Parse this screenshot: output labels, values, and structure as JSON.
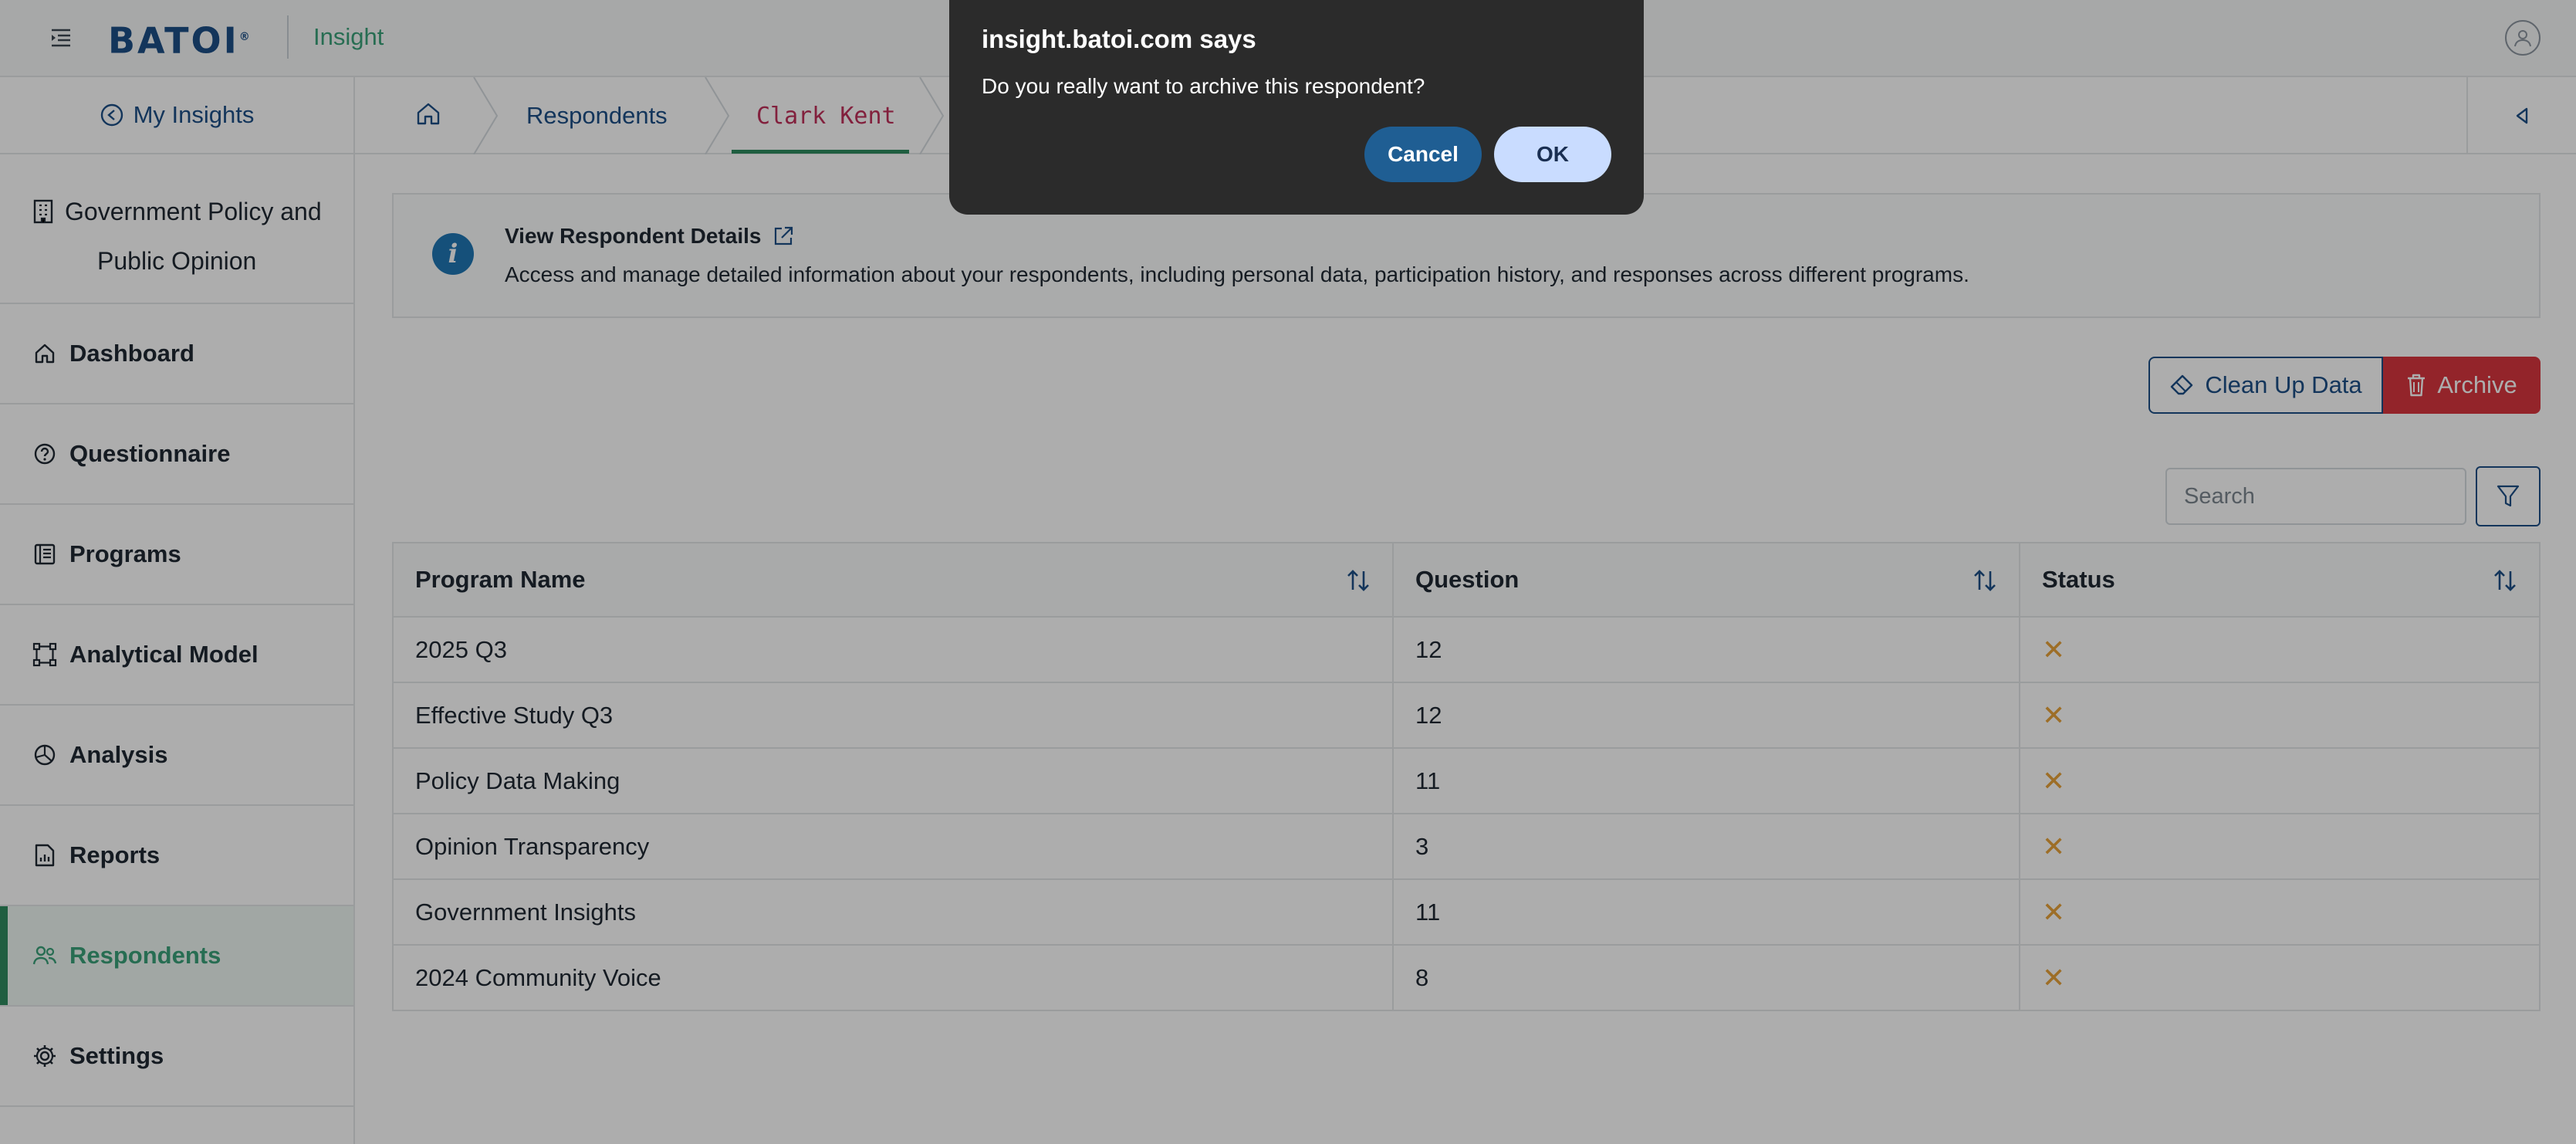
{
  "header": {
    "logo_text": "BATOI",
    "logo_reg": "®",
    "app_name": "Insight"
  },
  "sidebar": {
    "back_link": "My Insights",
    "project_line1": "Government Policy and",
    "project_line2": "Public Opinion",
    "items": [
      {
        "label": "Dashboard",
        "icon": "home-icon",
        "active": false
      },
      {
        "label": "Questionnaire",
        "icon": "question-circle-icon",
        "active": false
      },
      {
        "label": "Programs",
        "icon": "list-document-icon",
        "active": false
      },
      {
        "label": "Analytical Model",
        "icon": "model-nodes-icon",
        "active": false
      },
      {
        "label": "Analysis",
        "icon": "pie-chart-icon",
        "active": false
      },
      {
        "label": "Reports",
        "icon": "report-icon",
        "active": false
      },
      {
        "label": "Respondents",
        "icon": "users-icon",
        "active": true
      },
      {
        "label": "Settings",
        "icon": "gear-icon",
        "active": false
      }
    ]
  },
  "breadcrumb": {
    "items": [
      "Respondents",
      "Clark Kent"
    ]
  },
  "info": {
    "title": "View Respondent Details",
    "description": "Access and manage detailed information about your respondents, including personal data, participation history, and responses across different programs."
  },
  "actions": {
    "cleanup_label": "Clean Up Data",
    "archive_label": "Archive"
  },
  "search": {
    "placeholder": "Search",
    "value": ""
  },
  "table": {
    "columns": [
      "Program Name",
      "Question",
      "Status"
    ],
    "rows": [
      {
        "program": "2025 Q3",
        "question": "12",
        "status": "✕"
      },
      {
        "program": "Effective Study Q3",
        "question": "12",
        "status": "✕"
      },
      {
        "program": "Policy Data Making",
        "question": "11",
        "status": "✕"
      },
      {
        "program": "Opinion Transparency",
        "question": "3",
        "status": "✕"
      },
      {
        "program": "Government Insights",
        "question": "11",
        "status": "✕"
      },
      {
        "program": "2024 Community Voice",
        "question": "8",
        "status": "✕"
      }
    ]
  },
  "dialog": {
    "title": "insight.batoi.com says",
    "message": "Do you really want to archive this respondent?",
    "cancel_label": "Cancel",
    "ok_label": "OK"
  },
  "colors": {
    "brand_blue": "#1c4f86",
    "accent_green": "#3aa17a",
    "danger_red": "#d9363e",
    "status_warning": "#e8a23a"
  }
}
